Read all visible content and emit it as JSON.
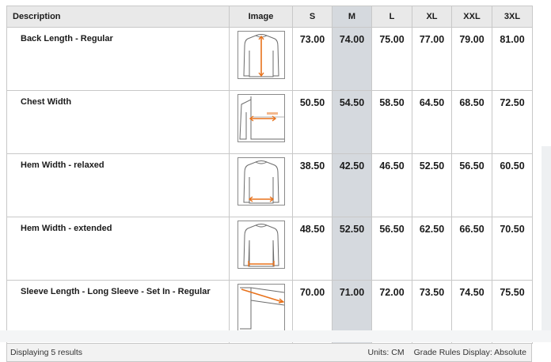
{
  "table": {
    "headers": {
      "description": "Description",
      "image": "Image",
      "sizes": [
        "S",
        "M",
        "L",
        "XL",
        "XXL",
        "3XL"
      ]
    },
    "highlight_color": "#d5d9de",
    "rows": [
      {
        "description": "Back Length - Regular",
        "icon": "garment-back-length-icon",
        "values": [
          "73.00",
          "74.00",
          "75.00",
          "77.00",
          "79.00",
          "81.00"
        ]
      },
      {
        "description": "Chest Width",
        "icon": "garment-chest-width-icon",
        "values": [
          "50.50",
          "54.50",
          "58.50",
          "64.50",
          "68.50",
          "72.50"
        ]
      },
      {
        "description": "Hem Width - relaxed",
        "icon": "garment-hem-width-relaxed-icon",
        "values": [
          "38.50",
          "42.50",
          "46.50",
          "52.50",
          "56.50",
          "60.50"
        ]
      },
      {
        "description": "Hem Width - extended",
        "icon": "garment-hem-width-extended-icon",
        "values": [
          "48.50",
          "52.50",
          "56.50",
          "62.50",
          "66.50",
          "70.50"
        ]
      },
      {
        "description": "Sleeve Length - Long Sleeve - Set In - Regular",
        "icon": "garment-sleeve-length-icon",
        "values": [
          "70.00",
          "71.00",
          "72.00",
          "73.50",
          "74.50",
          "75.50"
        ]
      }
    ]
  },
  "footer": {
    "results": "Displaying 5 results",
    "units": "Units: CM",
    "grade_rules": "Grade Rules Display: Absolute"
  },
  "accent_color": "#e8721c"
}
